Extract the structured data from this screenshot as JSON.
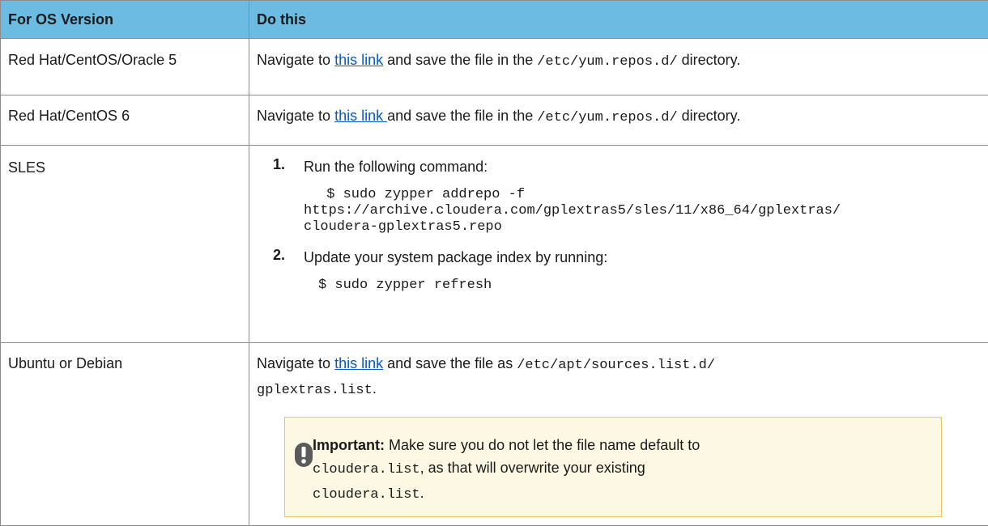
{
  "table": {
    "headers": [
      "For OS Version",
      "Do this"
    ],
    "rows": {
      "rh5": {
        "os": "Red Hat/CentOS/Oracle 5",
        "pre": "Navigate to ",
        "link": "this link",
        "mid": " and save the file in the ",
        "path": "/etc/yum.repos.d/",
        "post": " directory."
      },
      "rh6": {
        "os": "Red Hat/CentOS 6",
        "pre": "Navigate to ",
        "link": "this link ",
        "mid": " and save the file in the ",
        "path": "/etc/yum.repos.d/",
        "post": " directory."
      },
      "sles": {
        "os": "SLES",
        "steps": [
          {
            "num": "1.",
            "text": "Run the following command:",
            "code_lines": [
              " $ sudo zypper addrepo -f",
              "https://archive.cloudera.com/gplextras5/sles/11/x86_64/gplextras/",
              "cloudera-gplextras5.repo"
            ]
          },
          {
            "num": "2.",
            "text": "Update your system package index by running:",
            "code_lines": [
              "$ sudo zypper refresh"
            ]
          }
        ]
      },
      "ubuntu": {
        "os": "Ubuntu or Debian",
        "pre": "Navigate to ",
        "link": "this link",
        "mid": " and save the file as ",
        "path1": "/etc/apt/sources.list.d/",
        "path2": "gplextras.list",
        "post": ".",
        "important": {
          "label": "Important:",
          "text1": " Make sure you do not let the file name default to",
          "code1": "cloudera.list",
          "text2": ", as that will overwrite your existing",
          "code2": "cloudera.list",
          "text3": "."
        }
      }
    }
  },
  "colors": {
    "header_bg": "#6bbbe3",
    "link": "#0b57c9",
    "important_bg": "#fdf8e4",
    "important_border": "#f0c266"
  },
  "icons": [
    "important-icon"
  ]
}
